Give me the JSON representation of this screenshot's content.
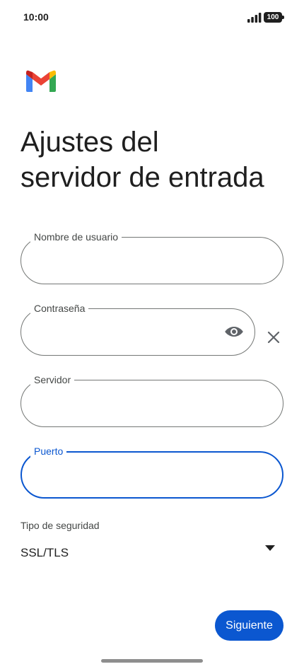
{
  "status_bar": {
    "time": "10:00",
    "battery": "100",
    "icons": [
      "signal-icon",
      "battery-icon"
    ]
  },
  "app": {
    "logo": "gmail-logo"
  },
  "page": {
    "title_line1": "Ajustes del",
    "title_line2": "servidor de entrada"
  },
  "form": {
    "username": {
      "label": "Nombre de usuario",
      "value": ""
    },
    "password": {
      "label": "Contraseña",
      "value": "",
      "icons": [
        "eye-icon",
        "clear-icon"
      ]
    },
    "server": {
      "label": "Servidor",
      "value": ""
    },
    "port": {
      "label": "Puerto",
      "value": "",
      "focused": true
    },
    "security": {
      "label": "Tipo de seguridad",
      "value": "SSL/TLS",
      "icon": "dropdown-icon"
    }
  },
  "actions": {
    "next_label": "Siguiente"
  },
  "colors": {
    "accent": "#0b57d0",
    "outline": "#747775",
    "text": "#1f1f1f",
    "secondary_text": "#444746",
    "gmail_blue": "#4285F4",
    "gmail_red": "#EA4335",
    "gmail_yellow": "#FBBC04",
    "gmail_green": "#34A853",
    "gmail_dark_red": "#C5221F"
  }
}
